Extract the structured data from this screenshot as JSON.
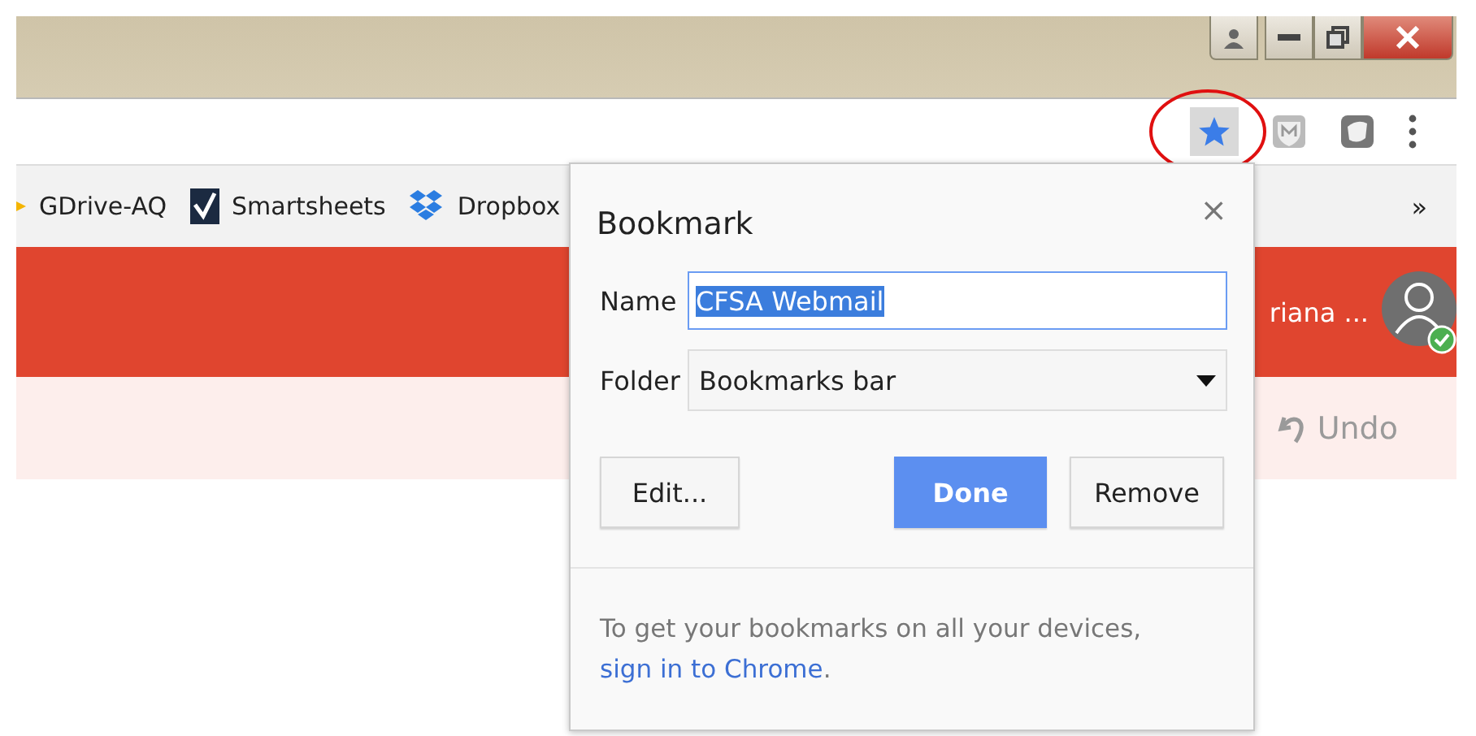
{
  "bookmarks_bar": {
    "items": [
      {
        "label": "GDrive-AQ",
        "kind": "drive"
      },
      {
        "label": "Smartsheets",
        "kind": "check"
      },
      {
        "label": "Dropbox",
        "kind": "box"
      }
    ],
    "overflow": "»"
  },
  "header": {
    "user_name": "riana ..."
  },
  "notice": {
    "undo": "Undo"
  },
  "dialog": {
    "title": "Bookmark",
    "close": "×",
    "name": {
      "label": "Name",
      "value": "CFSA Webmail",
      "text_selected": true
    },
    "folder": {
      "label": "Folder",
      "value": "Bookmarks bar"
    },
    "buttons": [
      {
        "label": "Edit...",
        "primary": false
      },
      {
        "label": "Done",
        "primary": true
      },
      {
        "label": "Remove",
        "primary": false
      }
    ],
    "footer": {
      "text": "To get your bookmarks on all your devices,",
      "link": "sign in to Chrome",
      "after_link": "."
    }
  }
}
